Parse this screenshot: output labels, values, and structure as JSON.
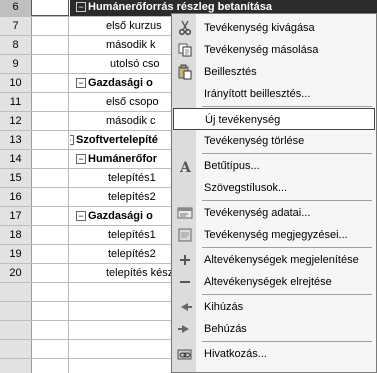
{
  "grid": {
    "rows": [
      {
        "num": "6",
        "text": "Humánerőforrás részleg betanítása",
        "style": "hdr",
        "indent": 18,
        "toggle": "minus",
        "bold": true
      },
      {
        "num": "7",
        "text": "első kurzus",
        "style": "",
        "indent": 36,
        "toggle": "",
        "bold": false
      },
      {
        "num": "8",
        "text": "második k",
        "style": "",
        "indent": 36,
        "toggle": "",
        "bold": false
      },
      {
        "num": "9",
        "text": "utolsó cso",
        "style": "",
        "indent": 40,
        "toggle": "",
        "bold": false
      },
      {
        "num": "10",
        "text": "Gazdasági o",
        "style": "",
        "indent": 18,
        "toggle": "minus",
        "bold": true
      },
      {
        "num": "11",
        "text": "első csopo",
        "style": "",
        "indent": 36,
        "toggle": "",
        "bold": false
      },
      {
        "num": "12",
        "text": "második c",
        "style": "",
        "indent": 36,
        "toggle": "",
        "bold": false
      },
      {
        "num": "13",
        "text": "Szoftvertelepíté",
        "style": "",
        "indent": 6,
        "toggle": "minus",
        "bold": true
      },
      {
        "num": "14",
        "text": "Humánerőfor",
        "style": "",
        "indent": 18,
        "toggle": "minus",
        "bold": true
      },
      {
        "num": "15",
        "text": "telepítés1",
        "style": "",
        "indent": 38,
        "toggle": "",
        "bold": false
      },
      {
        "num": "16",
        "text": "telepítés2",
        "style": "",
        "indent": 38,
        "toggle": "",
        "bold": false
      },
      {
        "num": "17",
        "text": "Gazdasági o",
        "style": "",
        "indent": 18,
        "toggle": "minus",
        "bold": true
      },
      {
        "num": "18",
        "text": "telepítés1",
        "style": "",
        "indent": 38,
        "toggle": "",
        "bold": false
      },
      {
        "num": "19",
        "text": "telepítés2",
        "style": "",
        "indent": 38,
        "toggle": "",
        "bold": false
      },
      {
        "num": "20",
        "text": "telepítés kész",
        "style": "",
        "indent": 36,
        "toggle": "",
        "bold": false
      }
    ]
  },
  "menu": {
    "items": [
      {
        "label": "Tevékenység kivágása",
        "icon": "scissors-icon",
        "group": 1
      },
      {
        "label": "Tevékenység másolása",
        "icon": "copy-icon",
        "group": 1
      },
      {
        "label": "Beillesztés",
        "icon": "paste-icon",
        "group": 1
      },
      {
        "label": "Irányított beillesztés...",
        "icon": "",
        "group": 1
      },
      {
        "label": "Új tevékenység",
        "icon": "",
        "group": 2,
        "selected": true
      },
      {
        "label": "Tevékenység törlése",
        "icon": "",
        "group": 2
      },
      {
        "label": "Betűtípus...",
        "icon": "font-icon",
        "group": 3
      },
      {
        "label": "Szövegstílusok...",
        "icon": "",
        "group": 3
      },
      {
        "label": "Tevékenység adatai...",
        "icon": "task-info-icon",
        "group": 4
      },
      {
        "label": "Tevékenység megjegyzései...",
        "icon": "task-notes-icon",
        "group": 4
      },
      {
        "label": "Altevékenységek megjelenítése",
        "icon": "show-subtasks-icon",
        "group": 5
      },
      {
        "label": "Altevékenységek elrejtése",
        "icon": "hide-subtasks-icon",
        "group": 5
      },
      {
        "label": "Kihúzás",
        "icon": "outdent-icon",
        "group": 6
      },
      {
        "label": "Behúzás",
        "icon": "indent-icon",
        "group": 6
      },
      {
        "label": "Hivatkozás...",
        "icon": "hyperlink-icon",
        "group": 7
      }
    ]
  }
}
